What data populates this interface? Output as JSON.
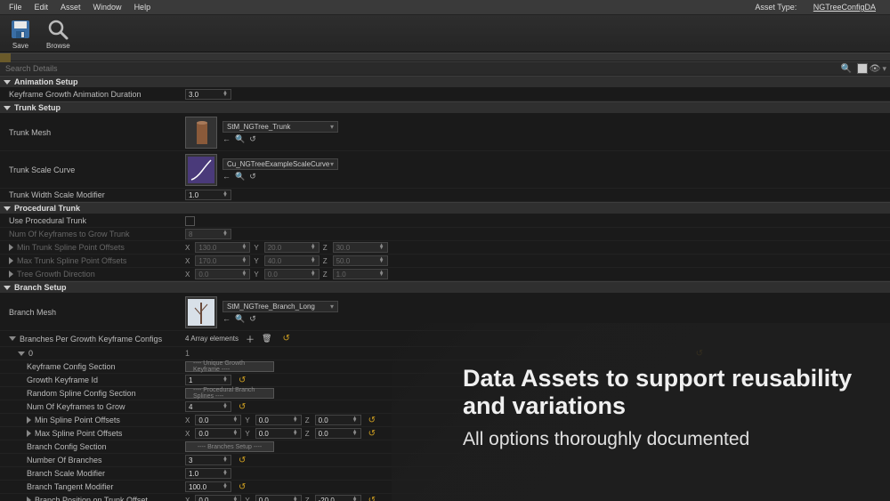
{
  "menu": {
    "items": [
      "File",
      "Edit",
      "Asset",
      "Window",
      "Help"
    ],
    "asset_type_label": "Asset Type:",
    "asset_type": "NGTreeConfigDA"
  },
  "toolbar": {
    "save": "Save",
    "browse": "Browse"
  },
  "search": {
    "placeholder": "Search Details"
  },
  "sections": {
    "anim": "Animation Setup",
    "trunk": "Trunk Setup",
    "proc": "Procedural Trunk",
    "branch": "Branch Setup"
  },
  "rows": {
    "kf_duration": {
      "label": "Keyframe Growth Animation Duration",
      "value": "3.0"
    },
    "trunk_mesh": {
      "label": "Trunk Mesh",
      "asset": "StM_NGTree_Trunk"
    },
    "trunk_scale": {
      "label": "Trunk Scale Curve",
      "asset": "Cu_NGTreeExampleScaleCurve"
    },
    "trunk_width": {
      "label": "Trunk Width Scale Modifier",
      "value": "1.0"
    },
    "use_proc": {
      "label": "Use Procedural Trunk"
    },
    "num_kf_trunk": {
      "label": "Num Of Keyframes to Grow Trunk",
      "value": "8"
    },
    "min_trunk_off": {
      "label": "Min Trunk Spline Point Offsets",
      "x": "130.0",
      "y": "20.0",
      "z": "30.0"
    },
    "max_trunk_off": {
      "label": "Max Trunk Spline Point Offsets",
      "x": "170.0",
      "y": "40.0",
      "z": "50.0"
    },
    "growth_dir": {
      "label": "Tree Growth Direction",
      "x": "0.0",
      "y": "0.0",
      "z": "1.0"
    },
    "branch_mesh": {
      "label": "Branch Mesh",
      "asset": "StM_NGTree_Branch_Long"
    },
    "bpg": {
      "label": "Branches Per Growth Keyframe Configs",
      "count": "4 Array elements"
    },
    "idx0": {
      "label": "0",
      "value": "1"
    },
    "kf_cfg_section": {
      "label": "Keyframe Config Section",
      "pill": "---- Unique Growth Keyframe ----"
    },
    "growth_kf_id": {
      "label": "Growth Keyframe Id",
      "value": "1"
    },
    "rand_spline": {
      "label": "Random Spline Config Section",
      "pill": "---- Procedural Branch Splines ----"
    },
    "num_kf_grow": {
      "label": "Num Of Keyframes to Grow",
      "value": "4"
    },
    "min_spline": {
      "label": "Min Spline Point Offsets",
      "x": "0.0",
      "y": "0.0",
      "z": "0.0"
    },
    "max_spline": {
      "label": "Max Spline Point Offsets",
      "x": "0.0",
      "y": "0.0",
      "z": "0.0"
    },
    "branch_cfg": {
      "label": "Branch Config Section",
      "pill": "---- Branches Setup ----"
    },
    "num_branches": {
      "label": "Number Of Branches",
      "value": "3"
    },
    "branch_scale_mod": {
      "label": "Branch Scale Modifier",
      "value": "1.0"
    },
    "branch_tan_mod": {
      "label": "Branch Tangent Modifier",
      "value": "100.0"
    },
    "branch_pos": {
      "label": "Branch Position on Trunk Offset",
      "x": "0.0",
      "y": "0.0",
      "z": "-20.0"
    }
  },
  "overlay": {
    "title": "Data Assets to support reusability and variations",
    "subtitle": "All options thoroughly documented"
  }
}
